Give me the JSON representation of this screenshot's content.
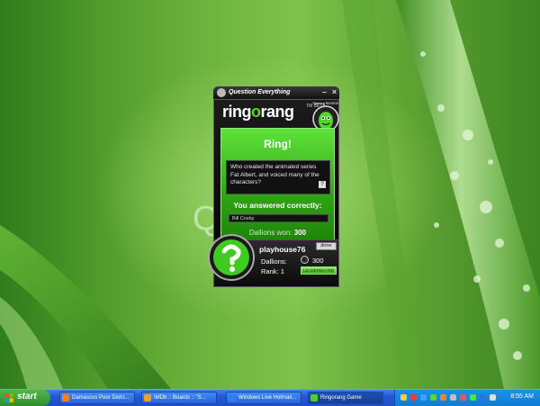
{
  "widget": {
    "title": "Question Everything",
    "logo_left": "ring",
    "logo_o": "o",
    "logo_right": "rang",
    "beta_label": "TM BETA",
    "mascot_label": "Flashing RINGED!",
    "heading": "Ring!",
    "question": "Who created the animated series Fat Albert, and voiced many of the characters?",
    "answered_label": "You answered correctly:",
    "answer": "Bill Cosby",
    "dallions_won_label": "Dallions won:",
    "dallions_won_value": "300",
    "done_label": "done",
    "username": "playhouse76",
    "dallions_label": "Dallions:",
    "dallions_value": "300",
    "rank_label": "Rank:",
    "rank_value": "1",
    "leaderboard_label": "LEADERBOARD"
  },
  "desktop": {
    "faint_logo": "Q          y."
  },
  "taskbar": {
    "start_label": "start",
    "tasks": [
      {
        "label": "Damascus Poor Distri...",
        "icon_color": "#f08020"
      },
      {
        "label": "IMDb :: Boards :: \"S...",
        "icon_color": "#f0a020"
      },
      {
        "label": "Windows Live Hotmail...",
        "icon_color": "#3080f0"
      },
      {
        "label": "Ringorang Game",
        "icon_color": "#50d030"
      }
    ],
    "clock": "8:55 AM"
  },
  "colors": {
    "accent_green": "#3bb51b",
    "taskbar_blue": "#2458d8"
  }
}
